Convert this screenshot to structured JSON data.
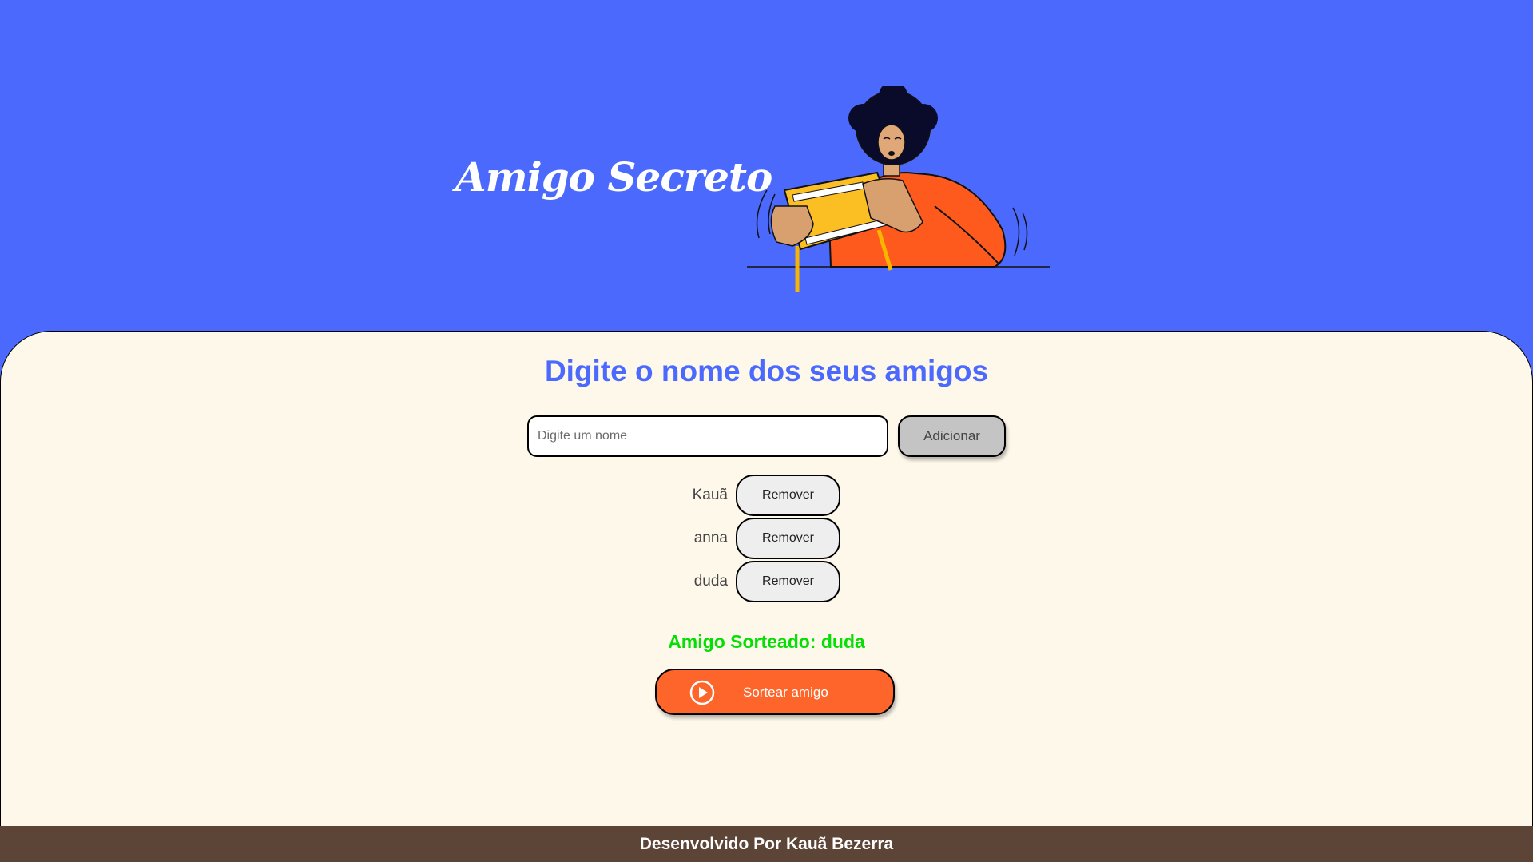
{
  "header": {
    "title": "Amigo Secreto",
    "illustration_icon": "person-playing-handheld-game-illustration"
  },
  "main": {
    "section_title": "Digite o nome dos seus amigos",
    "name_input": {
      "value": "",
      "placeholder": "Digite um nome"
    },
    "add_button_label": "Adicionar",
    "friends": [
      {
        "name": "Kauã",
        "remove_label": "Remover"
      },
      {
        "name": "anna",
        "remove_label": "Remover"
      },
      {
        "name": "duda",
        "remove_label": "Remover"
      }
    ],
    "result_text": "Amigo Sorteado: duda",
    "draw_button": {
      "label": "Sortear amigo",
      "icon": "play-circle-icon"
    }
  },
  "footer": {
    "text": "Desenvolvido Por Kauã Bezerra"
  },
  "colors": {
    "banner_background": "#4b69fd",
    "panel_background": "#fef8eb",
    "title_blue": "#4b69fd",
    "result_green": "#05df05",
    "draw_button_orange": "#fe652b",
    "add_button_gray": "#c4c4c4",
    "remove_button_gray": "#eeeeee",
    "footer_brown": "#5c4436"
  }
}
